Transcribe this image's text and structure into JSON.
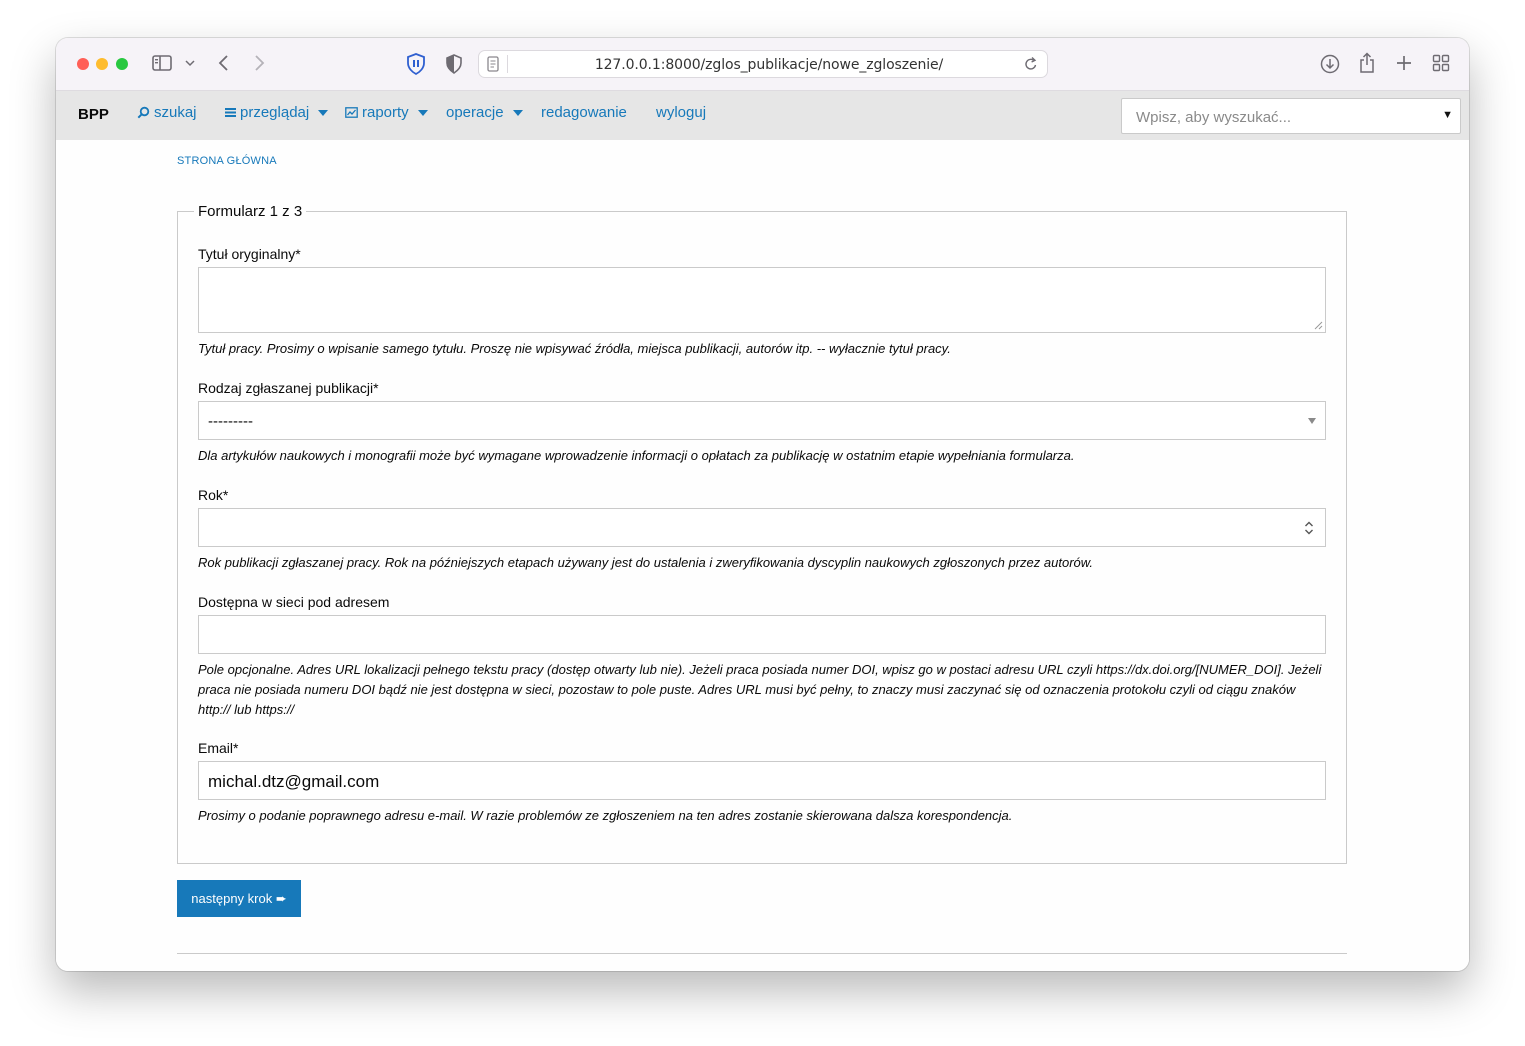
{
  "browser": {
    "url": "127.0.0.1:8000/zglos_publikacje/nowe_zgloszenie/"
  },
  "navbar": {
    "brand": "BPP",
    "items": [
      {
        "label": "szukaj"
      },
      {
        "label": "przeglądaj"
      },
      {
        "label": "raporty"
      },
      {
        "label": "operacje"
      },
      {
        "label": "redagowanie"
      },
      {
        "label": "wyloguj"
      }
    ],
    "search_placeholder": "Wpisz, aby wyszukać..."
  },
  "breadcrumb": "STRONA GŁÓWNA",
  "form": {
    "legend": "Formularz 1 z 3",
    "fields": {
      "title": {
        "label": "Tytuł oryginalny*",
        "value": "",
        "help": "Tytuł pracy. Prosimy o wpisanie samego tytułu. Proszę nie wpisywać źródła, miejsca publikacji, autorów itp. -- wyłacznie tytuł pracy."
      },
      "type": {
        "label": "Rodzaj zgłaszanej publikacji*",
        "selected": "---------",
        "help": "Dla artykułów naukowych i monografii może być wymagane wprowadzenie informacji o opłatach za publikację w ostatnim etapie wypełniania formularza."
      },
      "year": {
        "label": "Rok*",
        "value": "",
        "help": "Rok publikacji zgłaszanej pracy. Rok na późniejszych etapach używany jest do ustalenia i zweryfikowania dyscyplin naukowych zgłoszonych przez autorów."
      },
      "url": {
        "label": "Dostępna w sieci pod adresem",
        "value": "",
        "help": "Pole opcjonalne. Adres URL lokalizacji pełnego tekstu pracy (dostęp otwarty lub nie). Jeżeli praca posiada numer DOI, wpisz go w postaci adresu URL czyli https://dx.doi.org/[NUMER_DOI]. Jeżeli praca nie posiada numeru DOI bądź nie jest dostępna w sieci, pozostaw to pole puste. Adres URL musi być pełny, to znaczy musi zaczynać się od oznaczenia protokołu czyli od ciągu znaków http:// lub https://"
      },
      "email": {
        "label": "Email*",
        "value": "michal.dtz@gmail.com",
        "help": "Prosimy o podanie poprawnego adresu e-mail. W razie problemów ze zgłoszeniem na ten adres zostanie skierowana dalsza korespondencja."
      }
    },
    "next_button": "następny krok ➨"
  }
}
